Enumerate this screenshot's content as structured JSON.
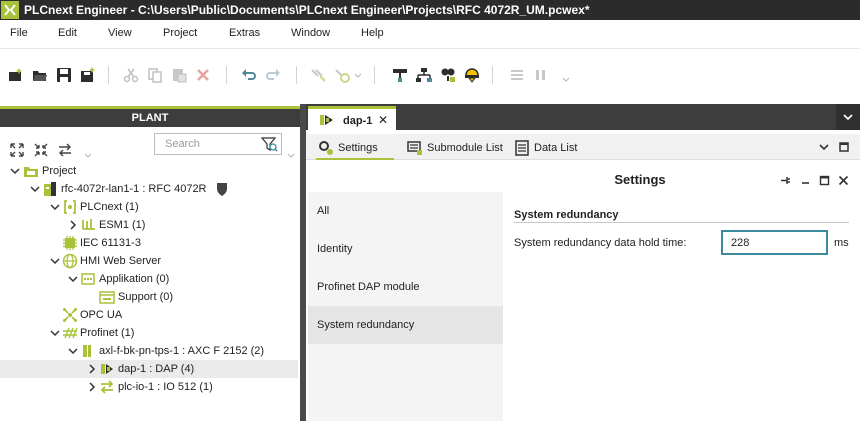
{
  "window": {
    "title": "PLCnext Engineer - C:\\Users\\Public\\Documents\\PLCnext Engineer\\Projects\\RFC 4072R_UM.pcwex*"
  },
  "menu": [
    "File",
    "Edit",
    "View",
    "Project",
    "Extras",
    "Window",
    "Help"
  ],
  "toolbar_icons": [
    "new-project-icon",
    "open-project-icon",
    "save-icon",
    "save-as-icon",
    "cut-icon",
    "copy-icon",
    "paste-icon",
    "delete-icon",
    "undo-icon",
    "redo-icon",
    "connect-icon",
    "online-icon",
    "network-scan-icon",
    "network-topology-icon",
    "debug-icon",
    "warning-icon",
    "grid-icon",
    "pause-icon"
  ],
  "plant": {
    "header": "PLANT",
    "search": {
      "placeholder": "Search",
      "value": ""
    },
    "tree": [
      {
        "label": "Project",
        "icon": "project-icon"
      },
      {
        "label": "rfc-4072r-lan1-1 : RFC 4072R",
        "icon": "controller-icon"
      },
      {
        "label": "PLCnext (1)",
        "icon": "plcnext-icon"
      },
      {
        "label": "ESM1 (1)",
        "icon": "esm-icon"
      },
      {
        "label": "IEC 61131-3",
        "icon": "iec-icon"
      },
      {
        "label": "HMI Web Server",
        "icon": "globe-icon"
      },
      {
        "label": "Applikation (0)",
        "icon": "application-icon"
      },
      {
        "label": "Support (0)",
        "icon": "folder-icon"
      },
      {
        "label": "OPC UA",
        "icon": "opcua-icon"
      },
      {
        "label": "Profinet (1)",
        "icon": "profinet-icon"
      },
      {
        "label": "axl-f-bk-pn-tps-1 : AXC F 2152 (2)",
        "icon": "bus-coupler-icon"
      },
      {
        "label": "dap-1 : DAP (4)",
        "icon": "dap-icon"
      },
      {
        "label": "plc-io-1 : IO 512 (1)",
        "icon": "io-exchange-icon"
      }
    ]
  },
  "editor": {
    "tab_label": "dap-1",
    "tab_close": "✕",
    "subtabs": [
      "Settings",
      "Submodule List",
      "Data List"
    ],
    "settings_title": "Settings",
    "categories": [
      "All",
      "Identity",
      "Profinet DAP module",
      "System redundancy"
    ],
    "active_category": "System redundancy",
    "section_title": "System redundancy",
    "field_label": "System redundancy data hold time:",
    "field_value": "228",
    "field_unit": "ms"
  },
  "colors": {
    "accent": "#a8c23a",
    "header_dark": "#3d3d3d",
    "titlebar": "#2b2b2b",
    "input_border": "#3d8a9c"
  }
}
